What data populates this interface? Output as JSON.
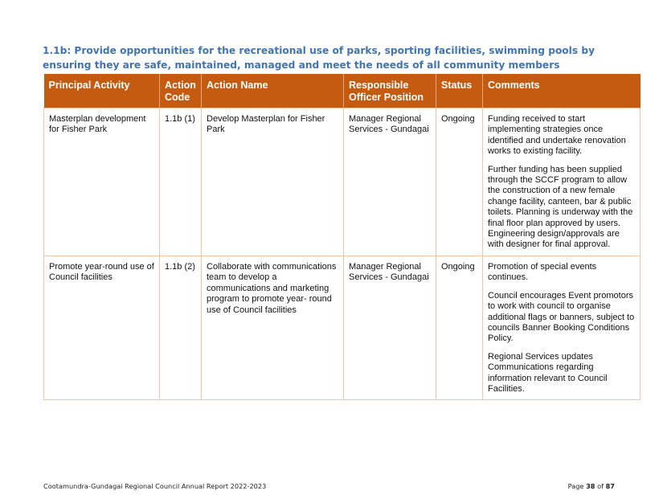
{
  "heading": "1.1b: Provide opportunities for the recreational use of parks, sporting facilities, swimming pools by ensuring they are safe, maintained, managed and meet the needs of all community members",
  "table": {
    "headers": {
      "principal_activity": "Principal Activity",
      "action_code": "Action Code",
      "action_name": "Action Name",
      "responsible_officer": "Responsible Officer Position",
      "status": "Status",
      "comments": "Comments"
    },
    "rows": [
      {
        "principal_activity": "Masterplan development for Fisher Park",
        "action_code": "1.1b (1)",
        "action_name": "Develop Masterplan for Fisher Park",
        "responsible_officer": "Manager Regional Services - Gundagai",
        "status": "Ongoing",
        "comments": [
          "Funding received to start implementing strategies once identified and undertake renovation works to existing facility.",
          "Further funding has been supplied through the SCCF program to allow the construction of a new female change facility, canteen, bar & public toilets. Planning is underway with the final floor plan approved by users. Engineering design/approvals are with designer for final approval."
        ]
      },
      {
        "principal_activity": "Promote year-round use of Council facilities",
        "action_code": "1.1b (2)",
        "action_name": "Collaborate with communications team to develop a communications and marketing program to promote year- round use of Council facilities",
        "responsible_officer": "Manager Regional Services - Gundagai",
        "status": "Ongoing",
        "comments": [
          "Promotion of special events continues.",
          "Council encourages Event promotors to work with council to organise additional flags or banners, subject to councils Banner Booking Conditions Policy.",
          "Regional Services updates Communications regarding information relevant to Council Facilities."
        ]
      }
    ]
  },
  "footer": {
    "report_title": "Cootamundra-Gundagai Regional Council Annual Report 2022-2023",
    "page_word": "Page",
    "page_number": "38",
    "of_word": "of",
    "total_pages": "87"
  },
  "colors": {
    "heading": "#3f74b6",
    "header_bg": "#c55a11",
    "border": "#f4c3a3"
  }
}
